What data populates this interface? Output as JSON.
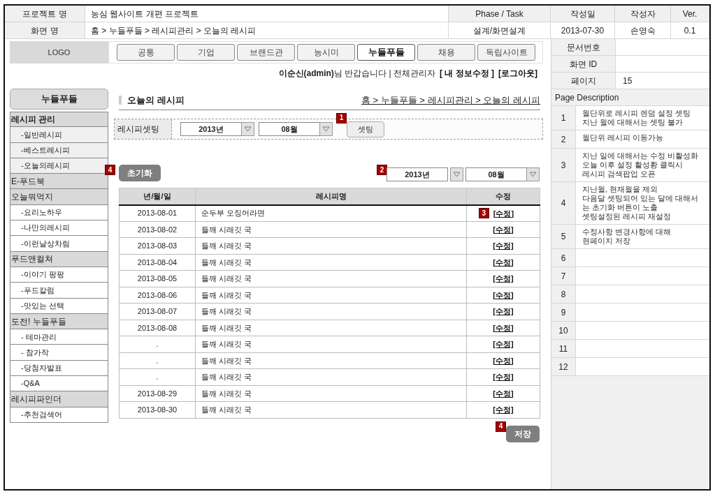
{
  "doc_header": {
    "project_label": "프로젝트 명",
    "project_name": "농심 웹사이트 개편 프로젝트",
    "phase_label": "Phase / Task",
    "date_label": "작성일",
    "author_label": "작성자",
    "version_label": "Ver.",
    "screen_label": "화면 명",
    "screen_name": "홈 > 누들푸들 > 레시피관리 > 오늘의 레시피",
    "phase": "설계/화면설계",
    "date": "2013-07-30",
    "author": "손영숙",
    "version": "0.1"
  },
  "logo": "LOGO",
  "nav_tabs": [
    {
      "label": "공통",
      "selected": false
    },
    {
      "label": "기업",
      "selected": false
    },
    {
      "label": "브랜드관",
      "selected": false
    },
    {
      "label": "농시미",
      "selected": false
    },
    {
      "label": "누들푸들",
      "selected": true
    },
    {
      "label": "채용",
      "selected": false
    },
    {
      "label": "독립사이트",
      "selected": false
    }
  ],
  "user_bar": {
    "greeting": "**이순신(admin)**님 반갑습니다 | 전체관리자",
    "links": [
      "[ 내 정보수정 ]",
      "[로그아웃]"
    ]
  },
  "sidebar": {
    "title": "누들푸들",
    "groups": [
      {
        "label": "레시피 관리",
        "selected": true,
        "children": [
          {
            "label": "-일반레시피"
          },
          {
            "label": "-베스트레시피"
          },
          {
            "label": "-오늘의레시피"
          }
        ]
      },
      {
        "label": "E-푸드북",
        "selected": false
      },
      {
        "label": "오늘뭐먹지",
        "selected": false,
        "children": [
          {
            "label": "-요리노하우"
          },
          {
            "label": "-나만의레시피"
          },
          {
            "label": "-이런날상차림"
          }
        ]
      },
      {
        "label": "푸드앤컬쳐",
        "selected": false,
        "children": [
          {
            "label": "-이야기 팡팡"
          },
          {
            "label": "-푸드칼럼"
          },
          {
            "label": "-맛있는 선택"
          }
        ]
      },
      {
        "label": "도전! 누들푸들",
        "selected": false,
        "children": [
          {
            "label": "- 테마관리"
          },
          {
            "label": "- 참가작"
          },
          {
            "label": "-당첨자발표"
          },
          {
            "label": "-Q&A"
          }
        ]
      },
      {
        "label": "레시피파인더",
        "selected": false,
        "children": [
          {
            "label": "-추천검색어"
          }
        ]
      }
    ]
  },
  "page_title": "오늘의 레시피",
  "breadcrumb": "홈 > 누들푸들 > 레시피관리 > 오늘의 레시피",
  "settings": {
    "label": "레시피셋팅",
    "year": "2013년",
    "month": "08월",
    "badge": "1",
    "button": "셋팅"
  },
  "filter": {
    "reset_badge": "4",
    "reset_button": "초기화",
    "badge": "2",
    "year": "2013년",
    "month": "08월"
  },
  "table": {
    "columns": [
      "년/월/일",
      "레시피명",
      "수정"
    ],
    "rows": [
      {
        "date": "2013-08-01",
        "name": "순두부 오징어라면",
        "badge": "3",
        "action": "[수정]"
      },
      {
        "date": "2013-08-02",
        "name": "들깨 시래깃 국",
        "action": "[수정]"
      },
      {
        "date": "2013-08-03",
        "name": "들깨 시래깃 국",
        "action": "[수정]"
      },
      {
        "date": "2013-08-04",
        "name": "들깨 시래깃 국",
        "action": "[수정]"
      },
      {
        "date": "2013-08-05",
        "name": "들깨 시래깃 국",
        "action": "[수정]"
      },
      {
        "date": "2013-08-06",
        "name": "들깨 시래깃 국",
        "action": "[수정]"
      },
      {
        "date": "2013-08-07",
        "name": "들깨 시래깃 국",
        "action": "[수정]"
      },
      {
        "date": "2013-08-08",
        "name": "들깨 시래깃 국",
        "action": "[수정]"
      },
      {
        "date": ".",
        "name": "들깨 시래깃 국",
        "action": "[수정]"
      },
      {
        "date": ".",
        "name": "들깨 시래깃 국",
        "action": "[수정]"
      },
      {
        "date": ".",
        "name": "들깨 시래깃 국",
        "action": "[수정]"
      },
      {
        "date": "2013-08-29",
        "name": "들깨 시래깃 국",
        "action": "[수정]"
      },
      {
        "date": "2013-08-30",
        "name": "들깨 시래깃 국",
        "action": "[수정]"
      }
    ]
  },
  "save": {
    "badge": "4",
    "button": "저장"
  },
  "doc_info": [
    {
      "label": "문서번호"
    },
    {
      "label": "화면 ID"
    },
    {
      "label": "페이지",
      "value": "15"
    }
  ],
  "page_description": {
    "title": "Page Description",
    "items": [
      {
        "number": "1",
        "text": "월단위로 레시피 렌덤 설정 셋팅\n지난 월에 대해서는 셋팅 불가"
      },
      {
        "number": "2",
        "text": "월단위 레시피 이동가능"
      },
      {
        "number": "3",
        "text": "지난 일에 대해서는 수정 비활성화\n오늘 이후 설정 활성황 클릭시\n레시피 검색팝업 오픈"
      },
      {
        "number": "4",
        "text": "지난월, 현재월을 제외\n다음달 셋팅되어 있는 달에 대해서\n는 초기화 버튼이 노출\n셋팅설정된 레시피 재설정"
      },
      {
        "number": "5",
        "text": "수정사항 변경사항에 대해\n현페이지 저장"
      },
      {
        "number": "6"
      },
      {
        "number": "7"
      },
      {
        "number": "8"
      },
      {
        "number": "9"
      },
      {
        "number": "10"
      },
      {
        "number": "11"
      },
      {
        "number": "12"
      }
    ]
  }
}
